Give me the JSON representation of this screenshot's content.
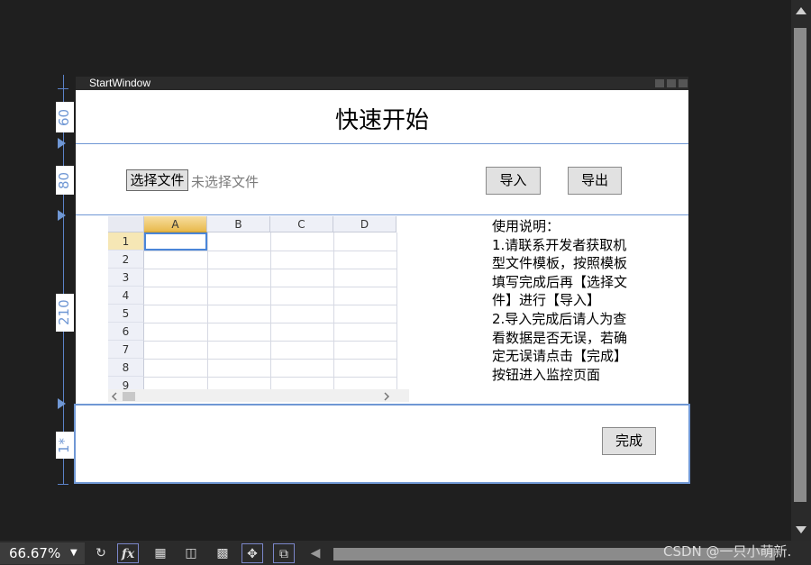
{
  "rulers": {
    "row1": "60",
    "row2": "80",
    "row3": "210",
    "row4": "1*"
  },
  "window": {
    "title": "StartWindow"
  },
  "heading": "快速开始",
  "file": {
    "choose_label": "选择文件",
    "status": "未选择文件"
  },
  "buttons": {
    "import": "导入",
    "export": "导出",
    "done": "完成"
  },
  "sheet": {
    "columns": [
      "A",
      "B",
      "C",
      "D"
    ],
    "rows": [
      "1",
      "2",
      "3",
      "4",
      "5",
      "6",
      "7",
      "8",
      "9"
    ]
  },
  "instructions": "使用说明：\n1.请联系开发者获取机\n型文件模板，按照模板\n填写完成后再【选择文\n件】进行【导入】\n2.导入完成后请人为查\n看数据是否无误，若确\n定无误请点击【完成】\n按钮进入监控页面",
  "toolbar": {
    "zoom": "66.67%",
    "fx": "fx"
  },
  "watermark": "CSDN @一只小萌新.",
  "colors": {
    "accent": "#6f97d4",
    "background": "#1f1f1f"
  }
}
